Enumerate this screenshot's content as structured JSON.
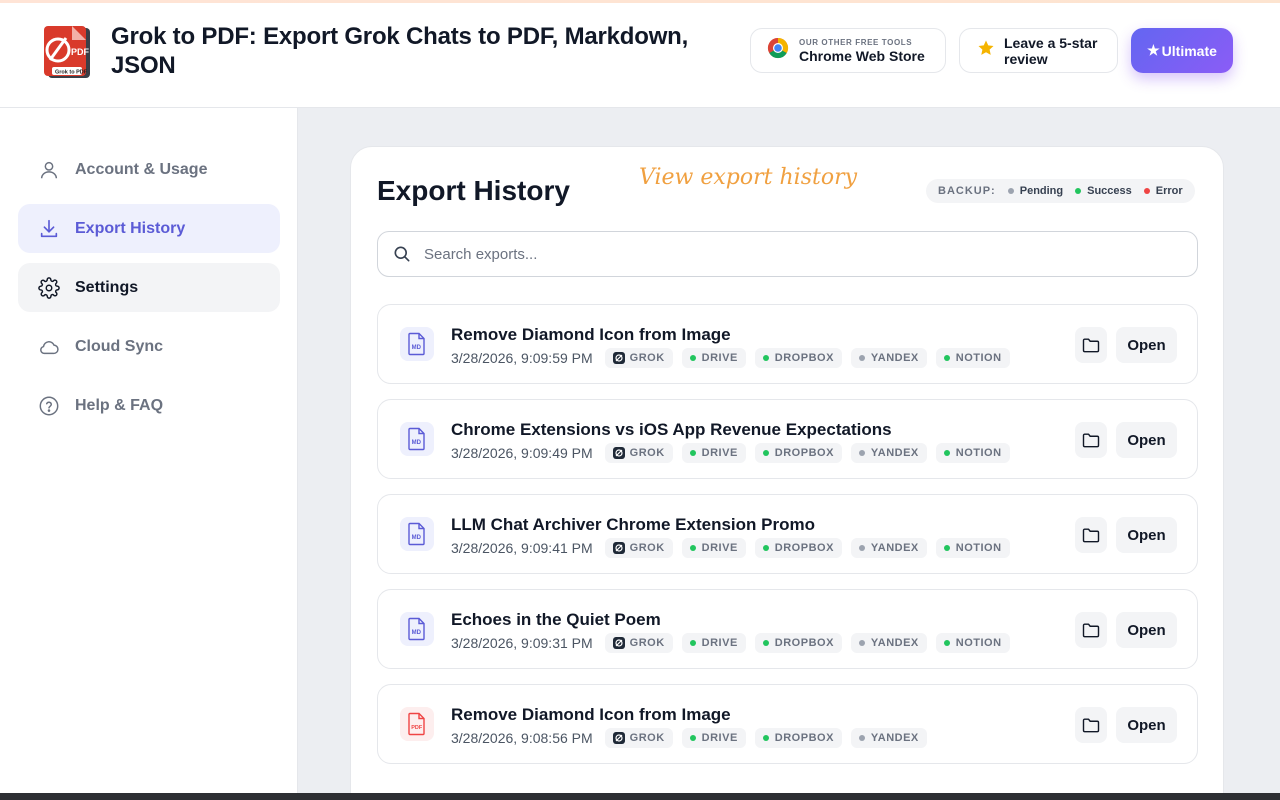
{
  "header": {
    "title": "Grok to PDF: Export Grok Chats to PDF, Markdown, JSON",
    "logo_text": "PDF",
    "logo_caption": "Grok to PDF",
    "cws_small": "OUR OTHER FREE TOOLS",
    "cws_big": "Chrome Web Store",
    "review_label": "Leave a 5-star review",
    "ultimate_label": "Ultimate"
  },
  "sidebar": {
    "items": [
      {
        "label": "Account & Usage",
        "icon": "user-icon",
        "state": "normal"
      },
      {
        "label": "Export History",
        "icon": "download-icon",
        "state": "active"
      },
      {
        "label": "Settings",
        "icon": "gear-icon",
        "state": "hover"
      },
      {
        "label": "Cloud Sync",
        "icon": "cloud-icon",
        "state": "normal"
      },
      {
        "label": "Help & FAQ",
        "icon": "help-icon",
        "state": "normal"
      }
    ]
  },
  "main": {
    "title": "Export History",
    "hint": "View export history",
    "legend": {
      "label": "BACKUP:",
      "items": [
        {
          "label": "Pending",
          "color": "#9ca3af"
        },
        {
          "label": "Success",
          "color": "#22c55e"
        },
        {
          "label": "Error",
          "color": "#ef4444"
        }
      ]
    },
    "search_placeholder": "Search exports...",
    "open_label": "Open",
    "rows": [
      {
        "title": "Remove Diamond Icon from Image",
        "date": "3/28/2026, 9:09:59 PM",
        "type": "MD",
        "source": "GROK",
        "backups": [
          {
            "label": "DRIVE",
            "status": "success"
          },
          {
            "label": "DROPBOX",
            "status": "success"
          },
          {
            "label": "YANDEX",
            "status": "pending"
          },
          {
            "label": "NOTION",
            "status": "success"
          }
        ]
      },
      {
        "title": "Chrome Extensions vs iOS App Revenue Expectations",
        "date": "3/28/2026, 9:09:49 PM",
        "type": "MD",
        "source": "GROK",
        "backups": [
          {
            "label": "DRIVE",
            "status": "success"
          },
          {
            "label": "DROPBOX",
            "status": "success"
          },
          {
            "label": "YANDEX",
            "status": "pending"
          },
          {
            "label": "NOTION",
            "status": "success"
          }
        ]
      },
      {
        "title": "LLM Chat Archiver Chrome Extension Promo",
        "date": "3/28/2026, 9:09:41 PM",
        "type": "MD",
        "source": "GROK",
        "backups": [
          {
            "label": "DRIVE",
            "status": "success"
          },
          {
            "label": "DROPBOX",
            "status": "success"
          },
          {
            "label": "YANDEX",
            "status": "pending"
          },
          {
            "label": "NOTION",
            "status": "success"
          }
        ]
      },
      {
        "title": "Echoes in the Quiet Poem",
        "date": "3/28/2026, 9:09:31 PM",
        "type": "MD",
        "source": "GROK",
        "backups": [
          {
            "label": "DRIVE",
            "status": "success"
          },
          {
            "label": "DROPBOX",
            "status": "success"
          },
          {
            "label": "YANDEX",
            "status": "pending"
          },
          {
            "label": "NOTION",
            "status": "success"
          }
        ]
      },
      {
        "title": "Remove Diamond Icon from Image",
        "date": "3/28/2026, 9:08:56 PM",
        "type": "PDF",
        "source": "GROK",
        "backups": [
          {
            "label": "DRIVE",
            "status": "success"
          },
          {
            "label": "DROPBOX",
            "status": "success"
          },
          {
            "label": "YANDEX",
            "status": "pending"
          }
        ]
      }
    ]
  },
  "colors": {
    "accent": "#5b5bd6",
    "success": "#22c55e",
    "pending": "#9ca3af",
    "error": "#ef4444",
    "hint": "#f0a040"
  }
}
